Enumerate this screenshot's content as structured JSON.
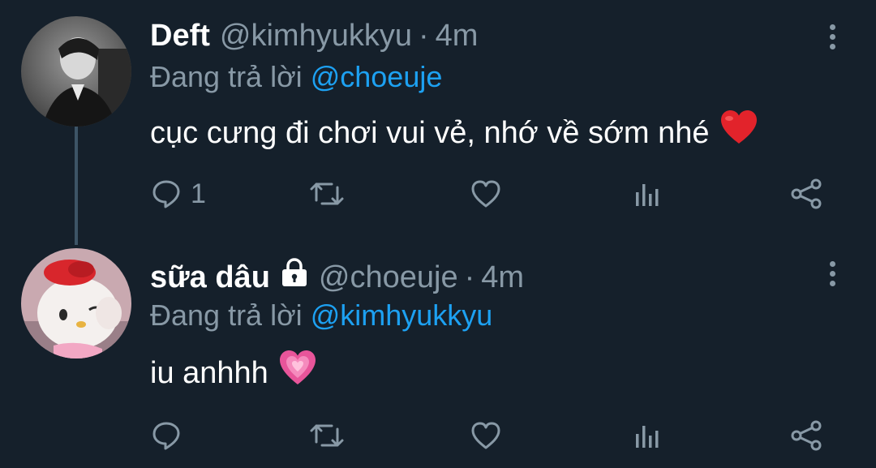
{
  "tweets": [
    {
      "display_name": "Deft",
      "handle": "@kimhyukkyu",
      "separator": "·",
      "time": "4m",
      "reply_prefix": "Đang trả lời",
      "reply_to": "@choeuje",
      "text": "cục cưng đi chơi vui vẻ, nhớ về sớm nhé",
      "emoji": "red-heart",
      "reply_count": "1",
      "protected": false
    },
    {
      "display_name": "sữa dâu",
      "handle": "@choeuje",
      "separator": "·",
      "time": "4m",
      "reply_prefix": "Đang trả lời",
      "reply_to": "@kimhyukkyu",
      "text": "iu anhhh",
      "emoji": "pink-heart",
      "reply_count": "",
      "protected": true
    }
  ],
  "icons": [
    "reply-icon",
    "retweet-icon",
    "like-icon",
    "analytics-icon",
    "share-icon",
    "more-options-icon",
    "lock-icon"
  ],
  "colors": {
    "background": "#15202b",
    "secondary_text": "#8899a6",
    "link": "#1da1f2",
    "thread_line": "#3d5466"
  }
}
